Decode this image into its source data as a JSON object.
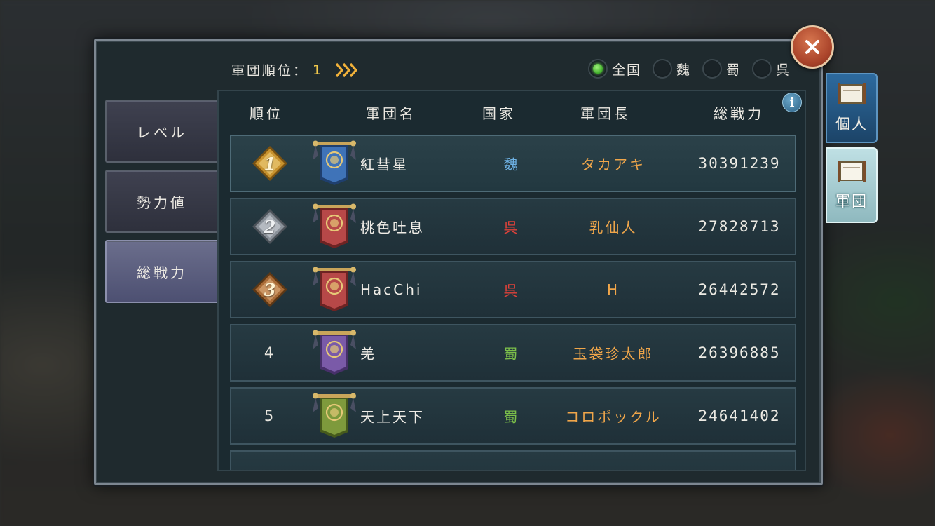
{
  "header": {
    "rank_label": "軍団順位：",
    "rank_value": "1"
  },
  "filters": [
    {
      "label": "全国",
      "selected": true
    },
    {
      "label": "魏",
      "selected": false
    },
    {
      "label": "蜀",
      "selected": false
    },
    {
      "label": "呉",
      "selected": false
    }
  ],
  "side_tabs": [
    {
      "label": "レベル",
      "active": false
    },
    {
      "label": "勢力値",
      "active": false
    },
    {
      "label": "総戦力",
      "active": true
    }
  ],
  "right_tabs": [
    {
      "label": "個人",
      "active": false
    },
    {
      "label": "軍団",
      "active": true
    }
  ],
  "table": {
    "headers": {
      "rank": "順位",
      "name": "軍団名",
      "country": "国家",
      "leader": "軍団長",
      "power": "総戦力"
    },
    "rows": [
      {
        "rank": "1",
        "name": "紅彗星",
        "country": "魏",
        "leader": "タカアキ",
        "power": "30391239",
        "banner": "blue",
        "medal": "gold"
      },
      {
        "rank": "2",
        "name": "桃色吐息",
        "country": "呉",
        "leader": "乳仙人",
        "power": "27828713",
        "banner": "red",
        "medal": "silver"
      },
      {
        "rank": "3",
        "name": "HacChi",
        "country": "呉",
        "leader": "H",
        "power": "26442572",
        "banner": "red",
        "medal": "bronze"
      },
      {
        "rank": "4",
        "name": "羌",
        "country": "蜀",
        "leader": "玉袋珍太郎",
        "power": "26396885",
        "banner": "purple",
        "medal": ""
      },
      {
        "rank": "5",
        "name": "天上天下",
        "country": "蜀",
        "leader": "コロポックル",
        "power": "24641402",
        "banner": "green",
        "medal": ""
      }
    ]
  },
  "colors": {
    "wei": "#6fb3e6",
    "wu": "#e0423a",
    "shu": "#7cc04a",
    "leader": "#f0a64a",
    "accent_gold": "#f2c94c"
  },
  "icons": {
    "close": "close-x-icon",
    "info": "info-icon",
    "chevrons": "triple-chevron-right-icon"
  }
}
